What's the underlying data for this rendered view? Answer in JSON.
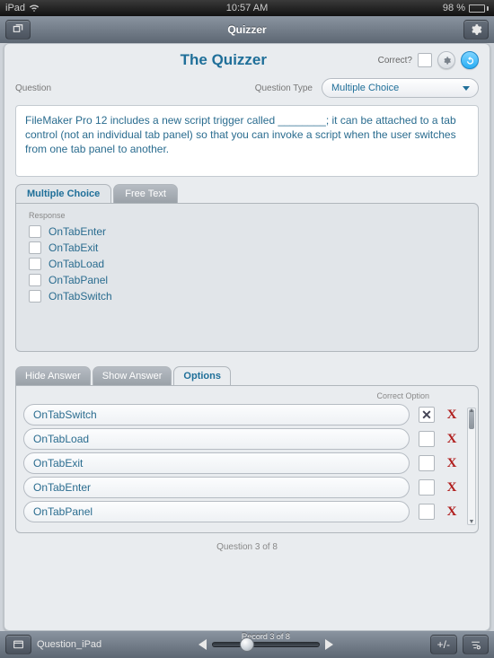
{
  "status": {
    "device": "iPad",
    "time": "10:57 AM",
    "battery_pct": "98 %"
  },
  "nav": {
    "title": "Quizzer"
  },
  "header": {
    "app_title": "The Quizzer",
    "correct_label": "Correct?"
  },
  "qmeta": {
    "question_label": "Question",
    "qtype_label": "Question Type",
    "qtype_value": "Multiple Choice"
  },
  "question_text": "FileMaker Pro 12 includes a new script trigger called ________; it can be attached to a tab control (not an individual tab panel) so that you can invoke a script when the user switches from one tab panel to another.",
  "response_tabs": {
    "mc": "Multiple Choice",
    "free": "Free Text",
    "response_label": "Response"
  },
  "responses": [
    "OnTabEnter",
    "OnTabExit",
    "OnTabLoad",
    "OnTabPanel",
    "OnTabSwitch"
  ],
  "lower_tabs": {
    "hide": "Hide Answer",
    "show": "Show Answer",
    "options": "Options"
  },
  "options_panel": {
    "correct_header": "Correct Option",
    "rows": [
      {
        "text": "OnTabSwitch",
        "correct": true
      },
      {
        "text": "OnTabLoad",
        "correct": false
      },
      {
        "text": "OnTabExit",
        "correct": false
      },
      {
        "text": "OnTabEnter",
        "correct": false
      },
      {
        "text": "OnTabPanel",
        "correct": false
      }
    ]
  },
  "pager": {
    "label": "Question 3 of 8"
  },
  "toolbar": {
    "layout": "Question_iPad",
    "record_caption": "Record 3 of 8"
  }
}
